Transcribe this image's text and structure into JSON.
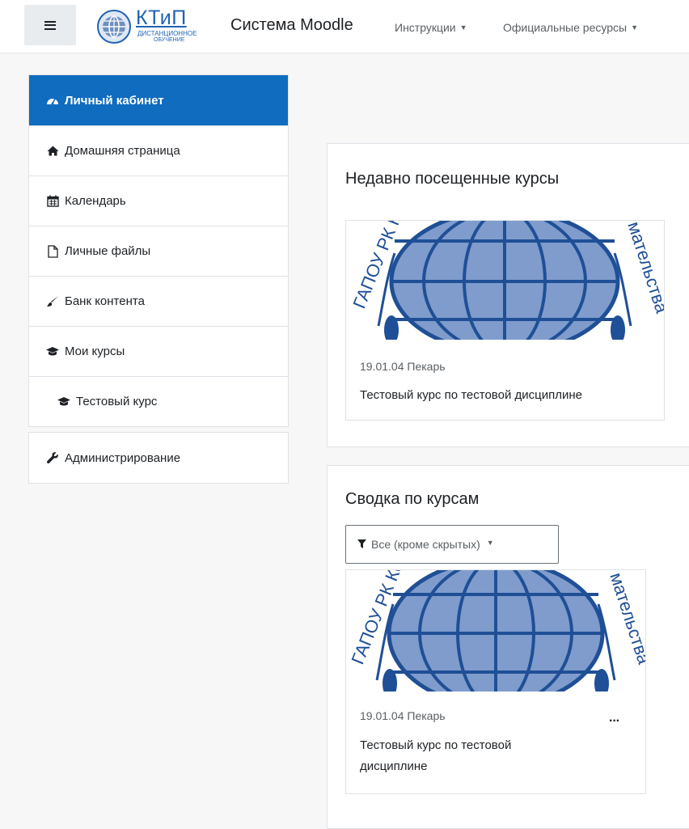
{
  "header": {
    "logo_main": "КТиП",
    "logo_sub1": "ДИСТАНЦИОННОЕ",
    "logo_sub2": "ОБУЧЕНИЕ",
    "site_name": "Система Moodle",
    "menus": [
      "Инструкции",
      "Официальные ресурсы"
    ]
  },
  "sidebar": {
    "items": [
      {
        "label": "Личный кабинет",
        "icon": "dashboard-icon"
      },
      {
        "label": "Домашняя страница",
        "icon": "home-icon"
      },
      {
        "label": "Календарь",
        "icon": "calendar-icon"
      },
      {
        "label": "Личные файлы",
        "icon": "file-icon"
      },
      {
        "label": "Банк контента",
        "icon": "paint-brush-icon"
      },
      {
        "label": "Мои курсы",
        "icon": "graduation-cap-icon"
      },
      {
        "label": "Тестовый курс",
        "icon": "graduation-cap-icon"
      }
    ],
    "admin": {
      "label": "Администрирование",
      "icon": "wrench-icon"
    }
  },
  "recent": {
    "title": "Недавно посещенные курсы",
    "course": {
      "category": "19.01.04 Пекарь",
      "name": "Тестовый курс по тестовой дисциплине"
    }
  },
  "overview": {
    "title": "Сводка по курсам",
    "filter": "Все (кроме скрытых)",
    "course": {
      "category": "19.01.04 Пекарь",
      "name_line1": "Тестовый курс по тестовой",
      "name_line2": "дисциплине",
      "menu": "···"
    }
  },
  "image_text": {
    "left": "ГАПОУ РК Ко",
    "right": "мательства"
  },
  "colors": {
    "accent": "#0f6cbf",
    "globe": "#6f8fbf",
    "logo": "#1f64b4"
  }
}
